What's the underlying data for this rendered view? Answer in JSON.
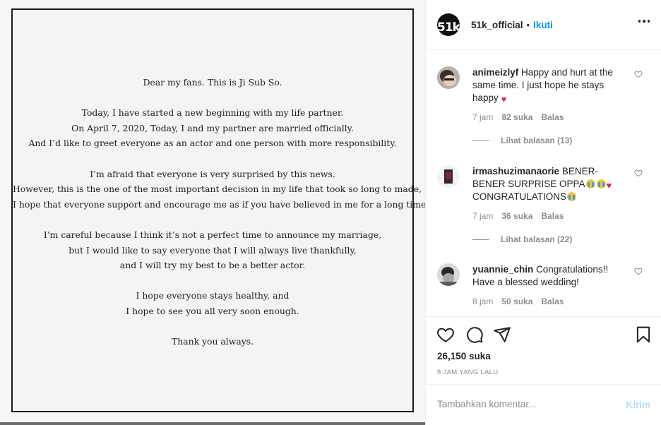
{
  "letter": {
    "paragraphs": [
      [
        "Dear my fans. This is Ji Sub So."
      ],
      [
        "Today, I have started a new beginning with my life partner.",
        "On April 7, 2020, Today, I and my partner are married officially.",
        "And I’d like to greet everyone as an actor and one person with more responsibility."
      ],
      [
        "I’m afraid that everyone is very surprised by this news.",
        "However, this is the one of the most important decision in my life that took so long to made,",
        "I hope that everyone support and encourage me as if you have believed in me for a long time."
      ],
      [
        "I’m careful because I think it’s not a perfect time to announce my marriage,",
        "but I would like to say everyone that I will always live thankfully,",
        "and I will try my best to be a better actor."
      ],
      [
        "I hope everyone stays healthy, and",
        "I hope to see you all very soon enough."
      ],
      [
        "Thank you always."
      ]
    ]
  },
  "header": {
    "avatar_text": "51k",
    "username": "51k_official",
    "separator": "•",
    "follow_label": "Ikuti"
  },
  "comments": [
    {
      "username": "animeizlyf",
      "text": "Happy and hurt at the same time. I just hope he stays happy",
      "time": "7 jam",
      "likes": "82 suka",
      "reply_label": "Balas",
      "view_replies": "Lihat balasan (13)"
    },
    {
      "username": "irmashuzimanaorie",
      "text_1": "BENER-BENER SURPRISE OPPA",
      "text_2": "CONGRATULATIONS",
      "time": "7 jam",
      "likes": "36 suka",
      "reply_label": "Balas",
      "view_replies": "Lihat balasan (22)"
    },
    {
      "username": "yuannie_chin",
      "text": "Congratulations!! Have a blessed wedding!",
      "time": "8 jam",
      "likes": "50 suka",
      "reply_label": "Balas"
    }
  ],
  "actions": {
    "like_count": "26,150 suka",
    "time_ago": "8 JAM YANG LALU"
  },
  "add_comment": {
    "placeholder": "Tambahkan komentar...",
    "post_label": "Kirim"
  },
  "colors": {
    "accent": "#0095f6",
    "post_disabled": "#b2dffc",
    "muted": "#8e8e8e",
    "heart_emoji": "#e0245e"
  },
  "icons": [
    "more-icon",
    "heart-icon",
    "comment-icon",
    "share-icon",
    "bookmark-icon"
  ]
}
